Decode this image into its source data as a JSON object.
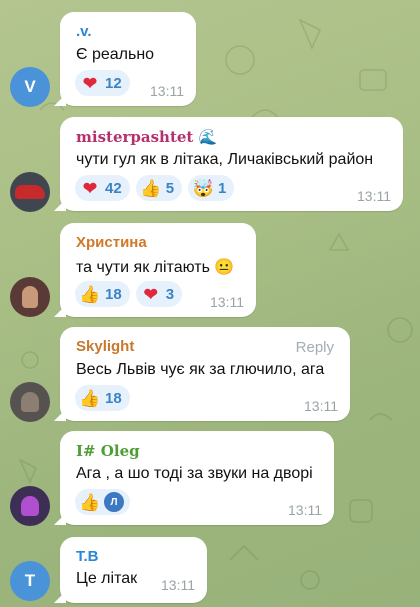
{
  "messages": [
    {
      "sender": ".v.",
      "sender_color": "#2b86d3",
      "text": "Є реально",
      "time": "13:11",
      "avatar": {
        "letter": "V",
        "color": "#4a93d8"
      },
      "reactions": [
        {
          "icon": "heart-icon",
          "glyph": "❤",
          "count": "12"
        }
      ]
    },
    {
      "sender": "misterpashtet 🌊",
      "sender_color": "#b5316c",
      "text": "чути гул як в літака, Личаківський район",
      "time": "13:11",
      "avatar": {
        "letter": "",
        "color": "#40464f"
      },
      "reactions": [
        {
          "icon": "heart-icon",
          "glyph": "❤",
          "count": "42"
        },
        {
          "icon": "thumbs-up-icon",
          "glyph": "👍",
          "count": "5"
        },
        {
          "icon": "exploding-head-icon",
          "glyph": "🤯",
          "count": "1"
        }
      ]
    },
    {
      "sender": "Христина",
      "sender_color": "#d3782a",
      "text": "та чути як літають 😐",
      "time": "13:11",
      "avatar": {
        "letter": "",
        "color": "#5a3a36"
      },
      "reactions": [
        {
          "icon": "thumbs-up-icon",
          "glyph": "👍",
          "count": "18"
        },
        {
          "icon": "heart-icon",
          "glyph": "❤",
          "count": "3"
        }
      ]
    },
    {
      "sender": "Skylight",
      "sender_color": "#c8792d",
      "reply_label": "Reply",
      "text": "Весь Львів чує як за глючило, ага",
      "time": "13:11",
      "avatar": {
        "letter": "",
        "color": "#56524f"
      },
      "reactions": [
        {
          "icon": "thumbs-up-icon",
          "glyph": "👍",
          "count": "18"
        }
      ]
    },
    {
      "sender": "I# Oleg",
      "sender_color": "#4f9d34",
      "text": "Ага , а шо тоді за звуки на дворі",
      "time": "13:11",
      "avatar": {
        "letter": "",
        "color": "#3c2e55"
      },
      "reactions": [
        {
          "icon": "thumbs-up-icon",
          "glyph": "👍",
          "count": "",
          "mini_avatar": "Л"
        }
      ]
    },
    {
      "sender": "T.B",
      "sender_color": "#2b86d3",
      "text": "Це літак",
      "time": "13:11",
      "avatar": {
        "letter": "T",
        "color": "#4a93d8"
      },
      "reactions": []
    }
  ]
}
